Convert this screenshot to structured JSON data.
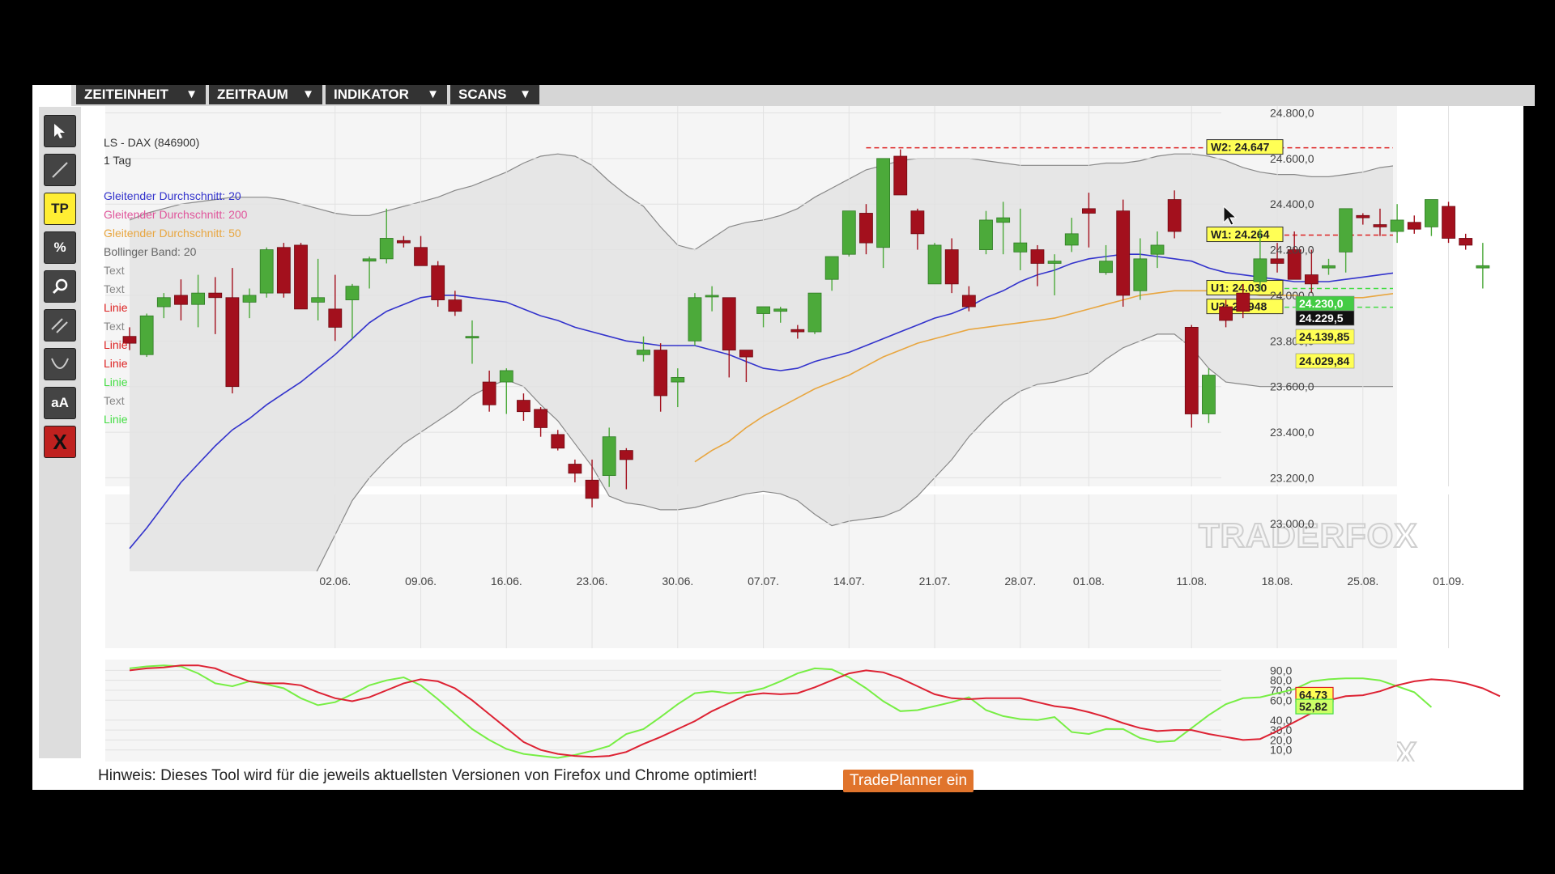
{
  "menu": {
    "items": [
      "ZEITEINHEIT",
      "ZEITRAUM",
      "INDIKATOR",
      "SCANS"
    ],
    "arrow": "▼"
  },
  "tools": [
    {
      "name": "pointer-tool",
      "label": "",
      "icon": "cursor-icon"
    },
    {
      "name": "line-tool",
      "label": "",
      "icon": "line-icon"
    },
    {
      "name": "tp-tool",
      "label": "TP",
      "icon": "tp-icon"
    },
    {
      "name": "percent-tool",
      "label": "%",
      "icon": "percent-icon"
    },
    {
      "name": "zoom-tool",
      "label": "",
      "icon": "magnifier-icon"
    },
    {
      "name": "parallel-lines-tool",
      "label": "",
      "icon": "parallel-lines-icon"
    },
    {
      "name": "curve-tool",
      "label": "",
      "icon": "curve-icon"
    },
    {
      "name": "text-tool",
      "label": "aA",
      "icon": "text-icon"
    },
    {
      "name": "delete-tool",
      "label": "X",
      "icon": "delete-icon"
    }
  ],
  "chart_data": {
    "type": "candlestick",
    "title": "LS - DAX (846900)",
    "subtitle": "1 Tag",
    "legend": [
      {
        "label": "Gleitender Durchschnitt: 20",
        "color": "#3333cc"
      },
      {
        "label": "Gleitender Durchschnitt: 200",
        "color": "#e0559b"
      },
      {
        "label": "Gleitender Durchschnitt: 50",
        "color": "#e8a640"
      },
      {
        "label": "Bollinger Band: 20",
        "color": "#666666"
      },
      {
        "label": "Text",
        "color": "#888888"
      },
      {
        "label": "Text",
        "color": "#888888"
      },
      {
        "label": "Linie",
        "color": "#dd2222"
      },
      {
        "label": "Text",
        "color": "#888888"
      },
      {
        "label": "Linie",
        "color": "#dd2222"
      },
      {
        "label": "Linie",
        "color": "#dd2222"
      },
      {
        "label": "Linie",
        "color": "#44dd44"
      },
      {
        "label": "Text",
        "color": "#888888"
      },
      {
        "label": "Linie",
        "color": "#44dd44"
      }
    ],
    "x_ticks": [
      "02.06.",
      "09.06.",
      "16.06.",
      "23.06.",
      "30.06.",
      "07.07.",
      "14.07.",
      "21.07.",
      "28.07.",
      "01.08.",
      "11.08.",
      "18.08.",
      "25.08.",
      "01.09."
    ],
    "x_tick_positions": [
      12,
      17,
      22,
      27,
      32,
      37,
      42,
      47,
      52,
      56,
      62,
      67,
      72,
      77
    ],
    "y_ticks": [
      "24.800,0",
      "24.600,0",
      "24.400,0",
      "24.200,0",
      "24.000,0",
      "23.800,0",
      "23.600,0",
      "23.400,0",
      "23.200,0",
      "23.000,0"
    ],
    "y_tick_values": [
      24800,
      24600,
      24400,
      24200,
      24000,
      23800,
      23600,
      23400,
      23200,
      23000
    ],
    "ylim": [
      22790,
      24830
    ],
    "grid": true,
    "candles": [
      [
        23820,
        23860,
        23760,
        23790
      ],
      [
        23740,
        23920,
        23730,
        23910
      ],
      [
        23950,
        24010,
        23900,
        23990
      ],
      [
        24000,
        24070,
        23890,
        23960
      ],
      [
        23960,
        24090,
        23860,
        24010
      ],
      [
        24010,
        24080,
        23830,
        23990
      ],
      [
        23990,
        24120,
        23570,
        23600
      ],
      [
        23970,
        24030,
        23900,
        24000
      ],
      [
        24010,
        24210,
        23990,
        24200
      ],
      [
        24210,
        24230,
        23990,
        24010
      ],
      [
        24220,
        24230,
        23940,
        23940
      ],
      [
        23970,
        24160,
        23890,
        23990
      ],
      [
        23940,
        24090,
        23800,
        23860
      ],
      [
        23980,
        24050,
        23810,
        24040
      ],
      [
        24150,
        24170,
        24030,
        24160
      ],
      [
        24160,
        24380,
        24140,
        24250
      ],
      [
        24240,
        24260,
        24210,
        24230
      ],
      [
        24210,
        24260,
        24130,
        24130
      ],
      [
        24130,
        24150,
        23950,
        23980
      ],
      [
        23980,
        24020,
        23910,
        23930
      ],
      [
        23820,
        23890,
        23700,
        23820
      ],
      [
        23620,
        23670,
        23490,
        23520
      ],
      [
        23620,
        23680,
        23480,
        23670
      ],
      [
        23540,
        23570,
        23450,
        23490
      ],
      [
        23500,
        23510,
        23380,
        23420
      ],
      [
        23390,
        23410,
        23320,
        23330
      ],
      [
        23260,
        23280,
        23180,
        23220
      ],
      [
        23190,
        23280,
        23070,
        23110
      ],
      [
        23210,
        23420,
        23160,
        23380
      ],
      [
        23320,
        23330,
        23150,
        23280
      ],
      [
        23740,
        23820,
        23710,
        23760
      ],
      [
        23760,
        23790,
        23490,
        23560
      ],
      [
        23620,
        23680,
        23510,
        23640
      ],
      [
        23800,
        24010,
        23780,
        23990
      ],
      [
        24000,
        24040,
        23930,
        24000
      ],
      [
        23990,
        23990,
        23640,
        23760
      ],
      [
        23760,
        23760,
        23620,
        23730
      ],
      [
        23920,
        23940,
        23860,
        23950
      ],
      [
        23930,
        23950,
        23880,
        23940
      ],
      [
        23850,
        23870,
        23810,
        23840
      ],
      [
        23840,
        24010,
        23830,
        24010
      ],
      [
        24070,
        24150,
        24020,
        24170
      ],
      [
        24180,
        24360,
        24170,
        24370
      ],
      [
        24360,
        24400,
        24180,
        24230
      ],
      [
        24210,
        24510,
        24120,
        24600
      ],
      [
        24610,
        24640,
        24460,
        24440
      ],
      [
        24370,
        24380,
        24200,
        24270
      ],
      [
        24050,
        24230,
        24060,
        24220
      ],
      [
        24200,
        24250,
        24010,
        24050
      ],
      [
        24000,
        24040,
        23930,
        23950
      ],
      [
        24200,
        24370,
        24180,
        24330
      ],
      [
        24320,
        24410,
        24180,
        24340
      ],
      [
        24190,
        24380,
        24110,
        24230
      ],
      [
        24200,
        24220,
        24040,
        24140
      ],
      [
        24140,
        24180,
        24000,
        24150
      ],
      [
        24220,
        24340,
        24190,
        24270
      ],
      [
        24380,
        24450,
        24210,
        24360
      ],
      [
        24100,
        24220,
        24090,
        24150
      ],
      [
        24370,
        24420,
        23950,
        24000
      ],
      [
        24020,
        24250,
        23980,
        24160
      ],
      [
        24180,
        24280,
        24120,
        24220
      ],
      [
        24420,
        24460,
        24250,
        24280
      ],
      [
        23860,
        23870,
        23420,
        23480
      ],
      [
        23480,
        23680,
        23440,
        23650
      ],
      [
        23950,
        23980,
        23860,
        23890
      ],
      [
        24010,
        24050,
        23900,
        23930
      ],
      [
        24060,
        24290,
        24020,
        24160
      ],
      [
        24160,
        24230,
        24100,
        24140
      ],
      [
        24200,
        24280,
        24130,
        24070
      ],
      [
        24090,
        24200,
        24010,
        24050
      ],
      [
        24120,
        24160,
        24090,
        24130
      ],
      [
        24190,
        24330,
        24100,
        24380
      ],
      [
        24350,
        24360,
        24310,
        24340
      ],
      [
        24310,
        24380,
        24260,
        24300
      ],
      [
        24280,
        24400,
        24230,
        24330
      ],
      [
        24320,
        24350,
        24270,
        24290
      ],
      [
        24300,
        24410,
        24260,
        24420
      ],
      [
        24390,
        24410,
        24230,
        24250
      ],
      [
        24250,
        24270,
        24200,
        24220
      ],
      [
        24120,
        24230,
        24030,
        24130
      ]
    ],
    "ma20": [
      22890,
      22980,
      23080,
      23180,
      23260,
      23340,
      23410,
      23460,
      23520,
      23570,
      23620,
      23680,
      23740,
      23810,
      23880,
      23930,
      23960,
      23990,
      24000,
      24000,
      23990,
      23980,
      23970,
      23940,
      23910,
      23890,
      23860,
      23840,
      23820,
      23800,
      23790,
      23780,
      23780,
      23780,
      23760,
      23740,
      23710,
      23680,
      23670,
      23680,
      23710,
      23730,
      23750,
      23780,
      23810,
      23840,
      23870,
      23900,
      23920,
      23950,
      23990,
      24020,
      24060,
      24090,
      24110,
      24140,
      24160,
      24170,
      24180,
      24180,
      24170,
      24160,
      24150,
      24120,
      24100,
      24090,
      24080,
      24070,
      24060,
      24060,
      24060,
      24070,
      24080,
      24090,
      24100,
      24100,
      24110,
      24120,
      24120,
      24130
    ],
    "ma50": [
      null,
      null,
      null,
      null,
      null,
      null,
      null,
      null,
      null,
      null,
      null,
      null,
      null,
      null,
      null,
      null,
      null,
      null,
      null,
      null,
      null,
      null,
      null,
      null,
      null,
      null,
      null,
      null,
      null,
      null,
      null,
      null,
      null,
      23270,
      23320,
      23360,
      23420,
      23470,
      23510,
      23550,
      23590,
      23620,
      23650,
      23690,
      23730,
      23760,
      23790,
      23810,
      23830,
      23850,
      23860,
      23870,
      23880,
      23890,
      23900,
      23920,
      23940,
      23960,
      23980,
      24000,
      24010,
      24020,
      24020,
      24020,
      24020,
      24010,
      24000,
      24000,
      24000,
      23990,
      23990,
      23990,
      23990,
      24000,
      24010,
      24020,
      24030,
      24040,
      24050,
      24060
    ],
    "bb_upper": [
      24330,
      24360,
      24380,
      24400,
      24410,
      24420,
      24430,
      24430,
      24430,
      24420,
      24400,
      24380,
      24360,
      24350,
      24350,
      24370,
      24390,
      24410,
      24430,
      24460,
      24480,
      24510,
      24540,
      24580,
      24610,
      24620,
      24610,
      24570,
      24500,
      24440,
      24390,
      24300,
      24220,
      24200,
      24250,
      24300,
      24320,
      24330,
      24350,
      24380,
      24430,
      24470,
      24510,
      24550,
      24570,
      24590,
      24600,
      24600,
      24600,
      24600,
      24590,
      24580,
      24570,
      24570,
      24570,
      24570,
      24570,
      24580,
      24580,
      24590,
      24610,
      24620,
      24620,
      24610,
      24590,
      24560,
      24540,
      24530,
      24530,
      24520,
      24520,
      24530,
      24540,
      24560,
      24570,
      24590,
      24600,
      24610,
      24620,
      24620
    ],
    "bb_lower": [
      21800,
      21850,
      21900,
      21950,
      22000,
      22050,
      22100,
      22250,
      22400,
      22500,
      22650,
      22800,
      22950,
      23100,
      23200,
      23280,
      23350,
      23400,
      23450,
      23500,
      23560,
      23600,
      23630,
      23600,
      23520,
      23450,
      23350,
      23250,
      23120,
      23090,
      23080,
      23060,
      23060,
      23070,
      23090,
      23110,
      23130,
      23140,
      23130,
      23100,
      23040,
      22990,
      23010,
      23020,
      23030,
      23060,
      23120,
      23200,
      23280,
      23380,
      23460,
      23530,
      23580,
      23610,
      23620,
      23640,
      23660,
      23720,
      23770,
      23800,
      23830,
      23830,
      23770,
      23680,
      23620,
      23610,
      23600,
      23600,
      23600,
      23600,
      23600,
      23600,
      23600,
      23600,
      23600,
      23600,
      23600,
      23600,
      23610,
      23610
    ],
    "price_labels": [
      {
        "text": "24.230,0",
        "value": 24230,
        "bg": "#44cc44",
        "fg": "#ffffff"
      },
      {
        "text": "24.229,5",
        "value": 24229.5,
        "bg": "#111111",
        "fg": "#ffffff"
      },
      {
        "text": "24.139,85",
        "value": 24139.85,
        "bg": "#ffff55",
        "fg": "#222222"
      },
      {
        "text": "24.029,84",
        "value": 24029.84,
        "bg": "#ffff55",
        "fg": "#222222"
      }
    ],
    "levels": [
      {
        "label": "W2: 24.647",
        "value": 24647,
        "color": "#dd2222"
      },
      {
        "label": "W1: 24.264",
        "value": 24264,
        "color": "#dd2222"
      },
      {
        "label": "U1: 24.030",
        "value": 24030,
        "color": "#44dd44"
      },
      {
        "label": "U2: 23.948",
        "value": 23948,
        "color": "#44dd44"
      }
    ],
    "watermark": "TRADERFOX",
    "oscillator": {
      "y_ticks": [
        "90,0",
        "80,0",
        "70,0",
        "60,0",
        "40,0",
        "30,0",
        "20,0",
        "10,0"
      ],
      "y_tick_values": [
        90,
        80,
        70,
        60,
        40,
        30,
        20,
        10
      ],
      "ylim": [
        0,
        96
      ],
      "labels": [
        {
          "text": "64,73",
          "value": 64.73,
          "bg": "#ffff55",
          "border": "#dd2222"
        },
        {
          "text": "52,82",
          "value": 52.82,
          "bg": "#ccff66",
          "border": "#44dd44"
        }
      ],
      "red": [
        90,
        92,
        93,
        95,
        95,
        92,
        85,
        79,
        77,
        77,
        75,
        68,
        62,
        59,
        63,
        70,
        77,
        81,
        79,
        72,
        60,
        46,
        32,
        18,
        10,
        6,
        4,
        3,
        4,
        8,
        16,
        23,
        31,
        39,
        49,
        57,
        65,
        67,
        66,
        67,
        73,
        80,
        87,
        90,
        88,
        82,
        74,
        66,
        62,
        61,
        62,
        62,
        62,
        58,
        54,
        52,
        48,
        43,
        37,
        32,
        29,
        30,
        30,
        26,
        23,
        20,
        21,
        29,
        38,
        47,
        60,
        64,
        65,
        69,
        75,
        79,
        81,
        80,
        77,
        72,
        64
      ],
      "green": [
        92,
        94,
        95,
        94,
        87,
        77,
        74,
        79,
        76,
        72,
        62,
        55,
        58,
        66,
        75,
        80,
        83,
        75,
        61,
        46,
        31,
        20,
        11,
        6,
        4,
        2,
        5,
        9,
        14,
        26,
        31,
        43,
        56,
        67,
        69,
        67,
        68,
        72,
        79,
        87,
        92,
        91,
        83,
        72,
        59,
        49,
        50,
        54,
        58,
        63,
        50,
        44,
        41,
        40,
        43,
        28,
        26,
        31,
        31,
        22,
        18,
        19,
        32,
        45,
        56,
        62,
        63,
        67,
        71,
        79,
        81,
        82,
        82,
        80,
        74,
        68,
        53
      ]
    }
  },
  "footer": {
    "hint": "Hinweis: Dieses Tool wird für die jeweils aktuellsten Versionen von Firefox und Chrome optimiert!",
    "button": "TradePlanner ein"
  }
}
